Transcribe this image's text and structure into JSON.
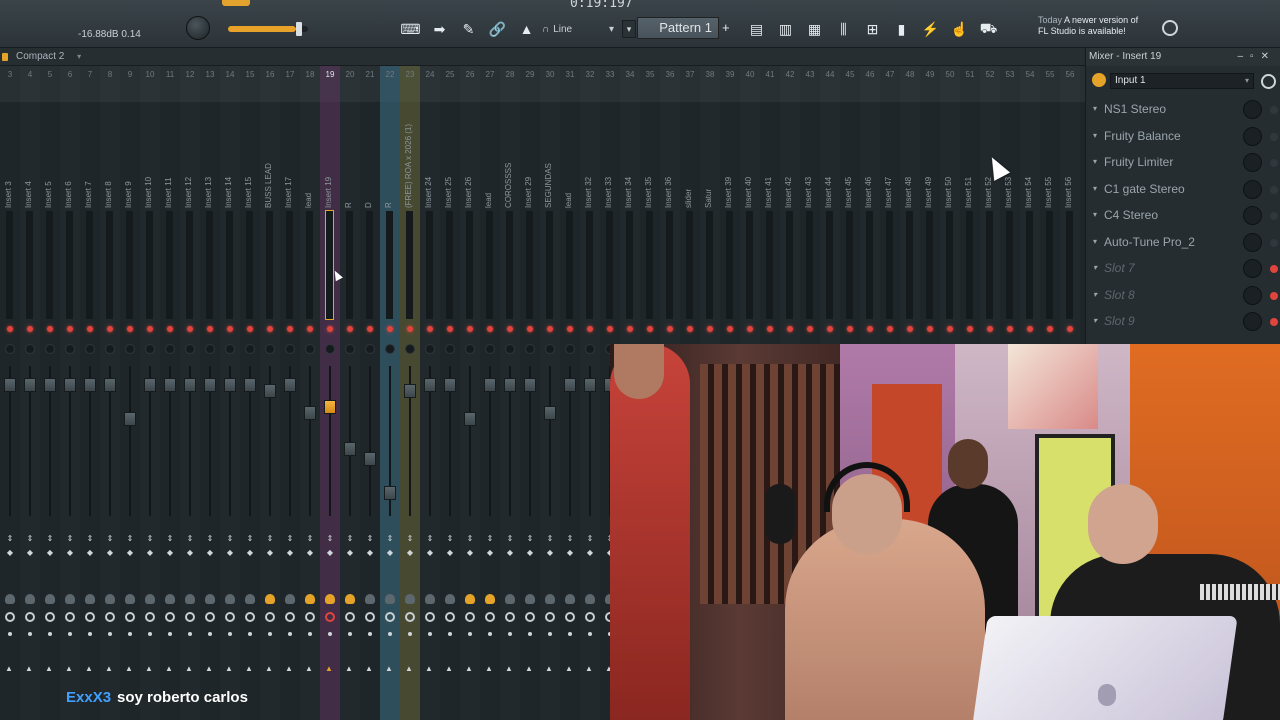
{
  "toolbar": {
    "volume_readout": "-16.88dB 0.14",
    "time": "0:19:197",
    "line_mode": "Line",
    "pattern": "Pattern 1",
    "news_day": "Today",
    "news_text_1": "A newer version of",
    "news_text_2": "FL Studio is available!",
    "master_volume_level": 0.85,
    "icons": [
      "piano-keys-icon",
      "arrow-right-icon",
      "brush-icon",
      "link-icon",
      "metronome-icon"
    ],
    "icons2": [
      "playlist-icon",
      "piano-roll-icon",
      "channel-rack-icon",
      "mixer-icon",
      "browser-icon",
      "file-icon",
      "plugin-icon",
      "touch-icon",
      "cart-icon"
    ]
  },
  "mixer": {
    "preset": "Compact 2",
    "tracks": [
      {
        "num": "3",
        "name": "Insert 3"
      },
      {
        "num": "4",
        "name": "Insert 4"
      },
      {
        "num": "5",
        "name": "Insert 5"
      },
      {
        "num": "6",
        "name": "Insert 6"
      },
      {
        "num": "7",
        "name": "Insert 7"
      },
      {
        "num": "8",
        "name": "Insert 8"
      },
      {
        "num": "9",
        "name": "Insert 9"
      },
      {
        "num": "10",
        "name": "Insert 10"
      },
      {
        "num": "11",
        "name": "Insert 11"
      },
      {
        "num": "12",
        "name": "Insert 12"
      },
      {
        "num": "13",
        "name": "Insert 13"
      },
      {
        "num": "14",
        "name": "Insert 14"
      },
      {
        "num": "15",
        "name": "Insert 15"
      },
      {
        "num": "16",
        "name": "BUSS LEAD"
      },
      {
        "num": "17",
        "name": "Insert 17"
      },
      {
        "num": "18",
        "name": "lead"
      },
      {
        "num": "19",
        "name": "Insert 19"
      },
      {
        "num": "20",
        "name": "R"
      },
      {
        "num": "21",
        "name": "D"
      },
      {
        "num": "22",
        "name": "R"
      },
      {
        "num": "23",
        "name": "(FREE) ROA x 2026 (1)"
      },
      {
        "num": "24",
        "name": "Insert 24"
      },
      {
        "num": "25",
        "name": "Insert 25"
      },
      {
        "num": "26",
        "name": "Insert 26"
      },
      {
        "num": "27",
        "name": "lead"
      },
      {
        "num": "28",
        "name": "COROSSSS"
      },
      {
        "num": "29",
        "name": "Insert 29"
      },
      {
        "num": "30",
        "name": "SEGUNDAS"
      },
      {
        "num": "31",
        "name": "lead"
      },
      {
        "num": "32",
        "name": "Insert 32"
      },
      {
        "num": "33",
        "name": "Insert 33"
      },
      {
        "num": "34",
        "name": "Insert 34"
      },
      {
        "num": "35",
        "name": "Insert 35"
      },
      {
        "num": "36",
        "name": "Insert 36"
      },
      {
        "num": "37",
        "name": "slider"
      },
      {
        "num": "38",
        "name": "Satur"
      },
      {
        "num": "39",
        "name": "Insert 39"
      },
      {
        "num": "40",
        "name": "Insert 40"
      },
      {
        "num": "41",
        "name": "Insert 41"
      },
      {
        "num": "42",
        "name": "Insert 42"
      },
      {
        "num": "43",
        "name": "Insert 43"
      },
      {
        "num": "44",
        "name": "Insert 44"
      },
      {
        "num": "45",
        "name": "Insert 45"
      },
      {
        "num": "46",
        "name": "Insert 46"
      },
      {
        "num": "47",
        "name": "Insert 47"
      },
      {
        "num": "48",
        "name": "Insert 48"
      },
      {
        "num": "49",
        "name": "Insert 49"
      },
      {
        "num": "50",
        "name": "Insert 50"
      },
      {
        "num": "51",
        "name": "Insert 51"
      },
      {
        "num": "52",
        "name": "Insert 52"
      },
      {
        "num": "53",
        "name": "Insert 53"
      },
      {
        "num": "54",
        "name": "Insert 54"
      },
      {
        "num": "55",
        "name": "Insert 55"
      },
      {
        "num": "56",
        "name": "Insert 56"
      }
    ],
    "selected_track": "Insert 19"
  },
  "fx_panel": {
    "title": "Mixer - Insert 19",
    "input": "Input 1",
    "slots": [
      {
        "label": "NS1 Stereo",
        "empty": false
      },
      {
        "label": "Fruity Balance",
        "empty": false
      },
      {
        "label": "Fruity Limiter",
        "empty": false
      },
      {
        "label": "C1 gate Stereo",
        "empty": false
      },
      {
        "label": "C4 Stereo",
        "empty": false
      },
      {
        "label": "Auto-Tune Pro_2",
        "empty": false
      },
      {
        "label": "Slot 7",
        "empty": true
      },
      {
        "label": "Slot 8",
        "empty": true
      },
      {
        "label": "Slot 9",
        "empty": true
      }
    ]
  },
  "chat": {
    "username": "ExxX3",
    "message": "soy roberto carlos"
  },
  "colors": {
    "accent": "#e6a32a",
    "selected_track": "#6b3a6a",
    "send_track": "#3c6f86",
    "chat_user": "#3fa0ff"
  }
}
